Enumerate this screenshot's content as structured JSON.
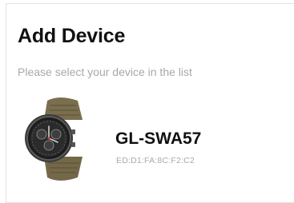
{
  "header": {
    "title": "Add Device",
    "subtitle": "Please select your device in the list"
  },
  "devices": [
    {
      "name": "GL-SWA57",
      "mac": "ED:D1:FA:8C:F2:C2",
      "icon": "smartwatch-icon"
    }
  ]
}
